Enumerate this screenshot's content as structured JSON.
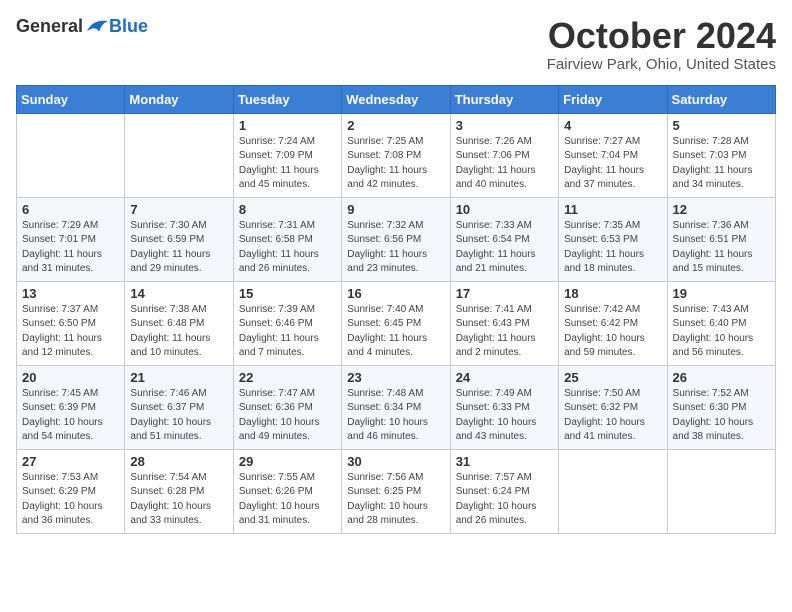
{
  "header": {
    "logo_general": "General",
    "logo_blue": "Blue",
    "month_title": "October 2024",
    "location": "Fairview Park, Ohio, United States"
  },
  "weekdays": [
    "Sunday",
    "Monday",
    "Tuesday",
    "Wednesday",
    "Thursday",
    "Friday",
    "Saturday"
  ],
  "weeks": [
    [
      {
        "day": "",
        "info": ""
      },
      {
        "day": "",
        "info": ""
      },
      {
        "day": "1",
        "info": "Sunrise: 7:24 AM\nSunset: 7:09 PM\nDaylight: 11 hours and 45 minutes."
      },
      {
        "day": "2",
        "info": "Sunrise: 7:25 AM\nSunset: 7:08 PM\nDaylight: 11 hours and 42 minutes."
      },
      {
        "day": "3",
        "info": "Sunrise: 7:26 AM\nSunset: 7:06 PM\nDaylight: 11 hours and 40 minutes."
      },
      {
        "day": "4",
        "info": "Sunrise: 7:27 AM\nSunset: 7:04 PM\nDaylight: 11 hours and 37 minutes."
      },
      {
        "day": "5",
        "info": "Sunrise: 7:28 AM\nSunset: 7:03 PM\nDaylight: 11 hours and 34 minutes."
      }
    ],
    [
      {
        "day": "6",
        "info": "Sunrise: 7:29 AM\nSunset: 7:01 PM\nDaylight: 11 hours and 31 minutes."
      },
      {
        "day": "7",
        "info": "Sunrise: 7:30 AM\nSunset: 6:59 PM\nDaylight: 11 hours and 29 minutes."
      },
      {
        "day": "8",
        "info": "Sunrise: 7:31 AM\nSunset: 6:58 PM\nDaylight: 11 hours and 26 minutes."
      },
      {
        "day": "9",
        "info": "Sunrise: 7:32 AM\nSunset: 6:56 PM\nDaylight: 11 hours and 23 minutes."
      },
      {
        "day": "10",
        "info": "Sunrise: 7:33 AM\nSunset: 6:54 PM\nDaylight: 11 hours and 21 minutes."
      },
      {
        "day": "11",
        "info": "Sunrise: 7:35 AM\nSunset: 6:53 PM\nDaylight: 11 hours and 18 minutes."
      },
      {
        "day": "12",
        "info": "Sunrise: 7:36 AM\nSunset: 6:51 PM\nDaylight: 11 hours and 15 minutes."
      }
    ],
    [
      {
        "day": "13",
        "info": "Sunrise: 7:37 AM\nSunset: 6:50 PM\nDaylight: 11 hours and 12 minutes."
      },
      {
        "day": "14",
        "info": "Sunrise: 7:38 AM\nSunset: 6:48 PM\nDaylight: 11 hours and 10 minutes."
      },
      {
        "day": "15",
        "info": "Sunrise: 7:39 AM\nSunset: 6:46 PM\nDaylight: 11 hours and 7 minutes."
      },
      {
        "day": "16",
        "info": "Sunrise: 7:40 AM\nSunset: 6:45 PM\nDaylight: 11 hours and 4 minutes."
      },
      {
        "day": "17",
        "info": "Sunrise: 7:41 AM\nSunset: 6:43 PM\nDaylight: 11 hours and 2 minutes."
      },
      {
        "day": "18",
        "info": "Sunrise: 7:42 AM\nSunset: 6:42 PM\nDaylight: 10 hours and 59 minutes."
      },
      {
        "day": "19",
        "info": "Sunrise: 7:43 AM\nSunset: 6:40 PM\nDaylight: 10 hours and 56 minutes."
      }
    ],
    [
      {
        "day": "20",
        "info": "Sunrise: 7:45 AM\nSunset: 6:39 PM\nDaylight: 10 hours and 54 minutes."
      },
      {
        "day": "21",
        "info": "Sunrise: 7:46 AM\nSunset: 6:37 PM\nDaylight: 10 hours and 51 minutes."
      },
      {
        "day": "22",
        "info": "Sunrise: 7:47 AM\nSunset: 6:36 PM\nDaylight: 10 hours and 49 minutes."
      },
      {
        "day": "23",
        "info": "Sunrise: 7:48 AM\nSunset: 6:34 PM\nDaylight: 10 hours and 46 minutes."
      },
      {
        "day": "24",
        "info": "Sunrise: 7:49 AM\nSunset: 6:33 PM\nDaylight: 10 hours and 43 minutes."
      },
      {
        "day": "25",
        "info": "Sunrise: 7:50 AM\nSunset: 6:32 PM\nDaylight: 10 hours and 41 minutes."
      },
      {
        "day": "26",
        "info": "Sunrise: 7:52 AM\nSunset: 6:30 PM\nDaylight: 10 hours and 38 minutes."
      }
    ],
    [
      {
        "day": "27",
        "info": "Sunrise: 7:53 AM\nSunset: 6:29 PM\nDaylight: 10 hours and 36 minutes."
      },
      {
        "day": "28",
        "info": "Sunrise: 7:54 AM\nSunset: 6:28 PM\nDaylight: 10 hours and 33 minutes."
      },
      {
        "day": "29",
        "info": "Sunrise: 7:55 AM\nSunset: 6:26 PM\nDaylight: 10 hours and 31 minutes."
      },
      {
        "day": "30",
        "info": "Sunrise: 7:56 AM\nSunset: 6:25 PM\nDaylight: 10 hours and 28 minutes."
      },
      {
        "day": "31",
        "info": "Sunrise: 7:57 AM\nSunset: 6:24 PM\nDaylight: 10 hours and 26 minutes."
      },
      {
        "day": "",
        "info": ""
      },
      {
        "day": "",
        "info": ""
      }
    ]
  ]
}
